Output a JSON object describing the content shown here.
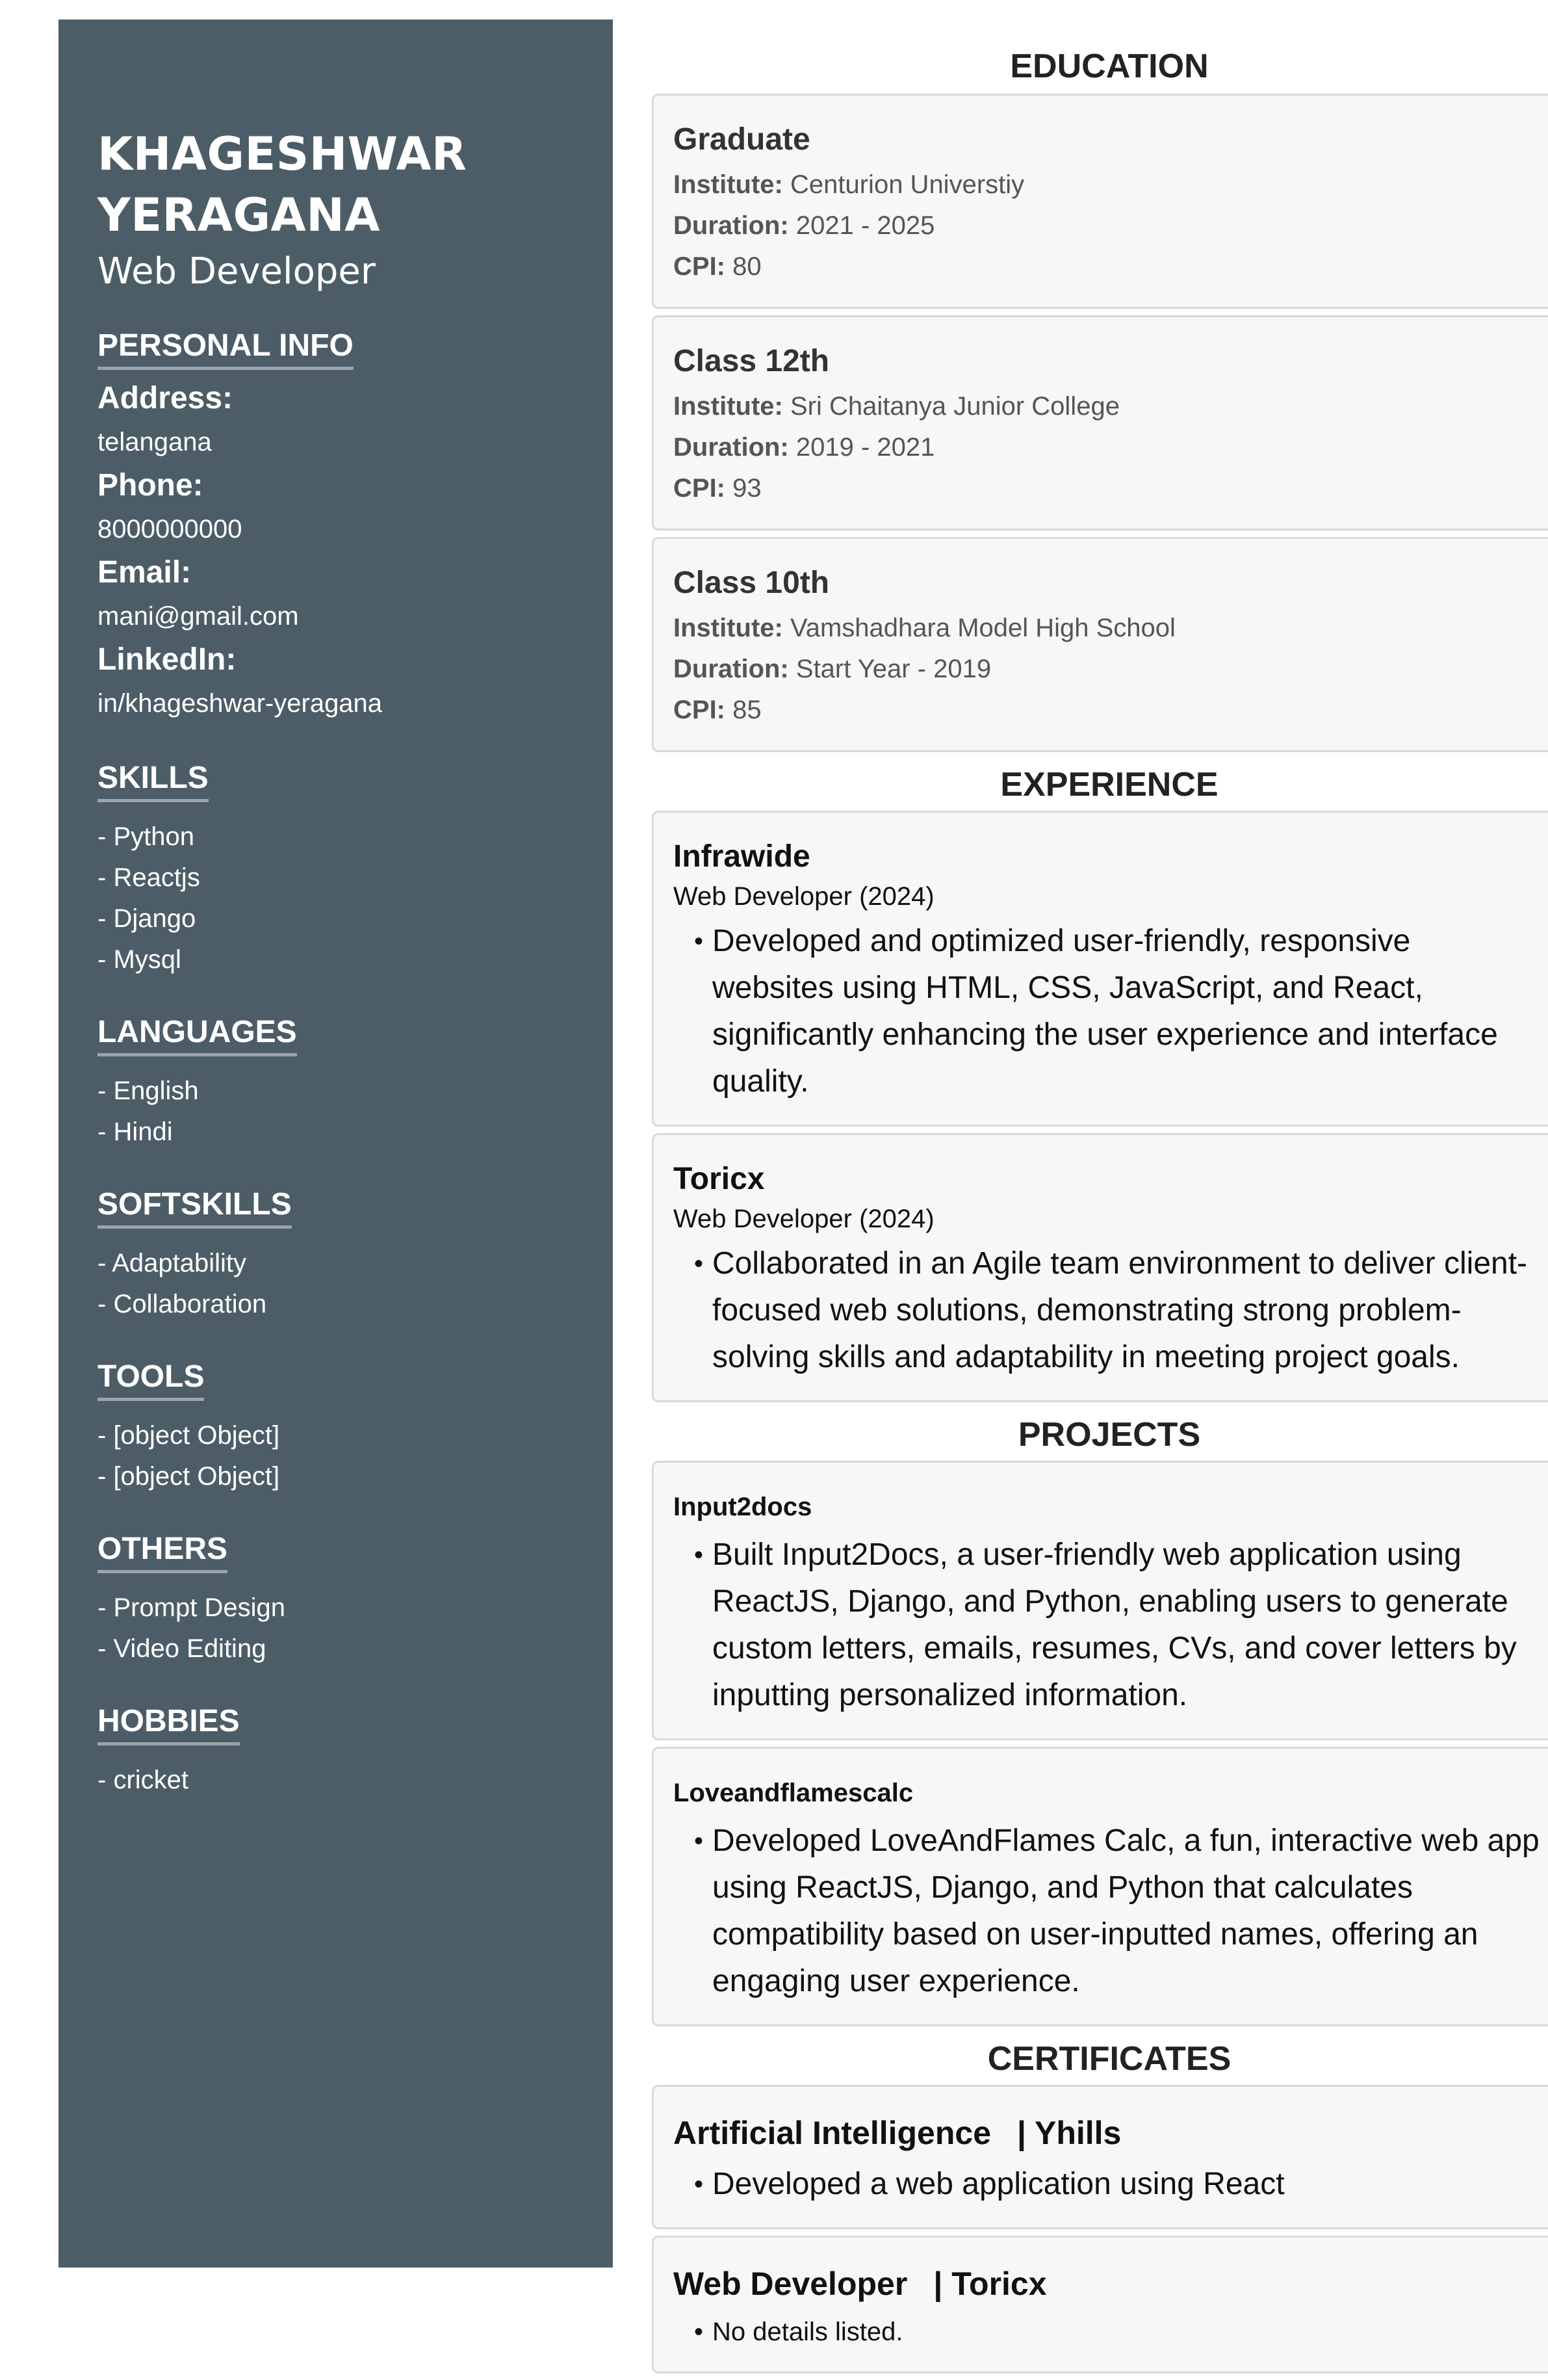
{
  "profile": {
    "name_line1": "KHAGESHWAR",
    "name_line2": "YERAGANA",
    "title": "Web Developer"
  },
  "personal_info": {
    "heading": "PERSONAL INFO",
    "fields": [
      {
        "label": "Address:",
        "value": "telangana"
      },
      {
        "label": "Phone:",
        "value": "8000000000"
      },
      {
        "label": "Email:",
        "value": "mani@gmail.com"
      },
      {
        "label": "LinkedIn:",
        "value": "in/khageshwar-yeragana"
      }
    ]
  },
  "skills": {
    "heading": "SKILLS",
    "items": [
      "Python",
      "Reactjs",
      "Django",
      "Mysql"
    ]
  },
  "languages": {
    "heading": "LANGUAGES",
    "items": [
      "English",
      "Hindi"
    ]
  },
  "softskills": {
    "heading": "SOFTSKILLS",
    "items": [
      "Adaptability",
      "Collaboration"
    ]
  },
  "tools": {
    "heading": "TOOLS",
    "items": [
      "[object Object]",
      "[object Object]"
    ]
  },
  "others": {
    "heading": "OTHERS",
    "items": [
      "Prompt Design",
      "Video Editing"
    ]
  },
  "hobbies": {
    "heading": "HOBBIES",
    "items": [
      "cricket"
    ]
  },
  "education": {
    "heading": "EDUCATION",
    "labels": {
      "institute": "Institute:",
      "duration": "Duration:",
      "cpi": "CPI:"
    },
    "entries": [
      {
        "title": "Graduate",
        "institute": "Centurion Universtiy",
        "duration": "2021 - 2025",
        "cpi": "80"
      },
      {
        "title": "Class 12th",
        "institute": "Sri Chaitanya Junior College",
        "duration": "2019 - 2021",
        "cpi": "93"
      },
      {
        "title": "Class 10th",
        "institute": "Vamshadhara Model High School",
        "duration": "Start Year - 2019",
        "cpi": "85"
      }
    ]
  },
  "experience": {
    "heading": "EXPERIENCE",
    "entries": [
      {
        "company": "Infrawide",
        "role": "Web Developer (2024)",
        "bullet": "Developed and optimized user-friendly, responsive websites using HTML, CSS, JavaScript, and React, significantly enhancing the user experience and interface quality."
      },
      {
        "company": "Toricx",
        "role": "Web Developer (2024)",
        "bullet": "Collaborated in an Agile team environment to deliver client-focused web solutions, demonstrating strong problem-solving skills and adaptability in meeting project goals."
      }
    ]
  },
  "projects": {
    "heading": "PROJECTS",
    "entries": [
      {
        "title": "Input2docs",
        "bullet": "Built Input2Docs, a user-friendly web application using ReactJS, Django, and Python, enabling users to generate custom letters, emails, resumes, CVs, and cover letters by inputting personalized information."
      },
      {
        "title": "Loveandflamescalc",
        "bullet": "Developed LoveAndFlames Calc, a fun, interactive web app using ReactJS, Django, and Python that calculates compatibility based on user-inputted names, offering an engaging user experience."
      }
    ]
  },
  "certificates": {
    "heading": "CERTIFICATES",
    "entries": [
      {
        "name": "Artificial Intelligence",
        "issuer": "| Yhills",
        "bullet": "Developed a web application using React"
      },
      {
        "name": "Web Developer",
        "issuer": "| Toricx",
        "bullet": "No details listed."
      }
    ]
  }
}
